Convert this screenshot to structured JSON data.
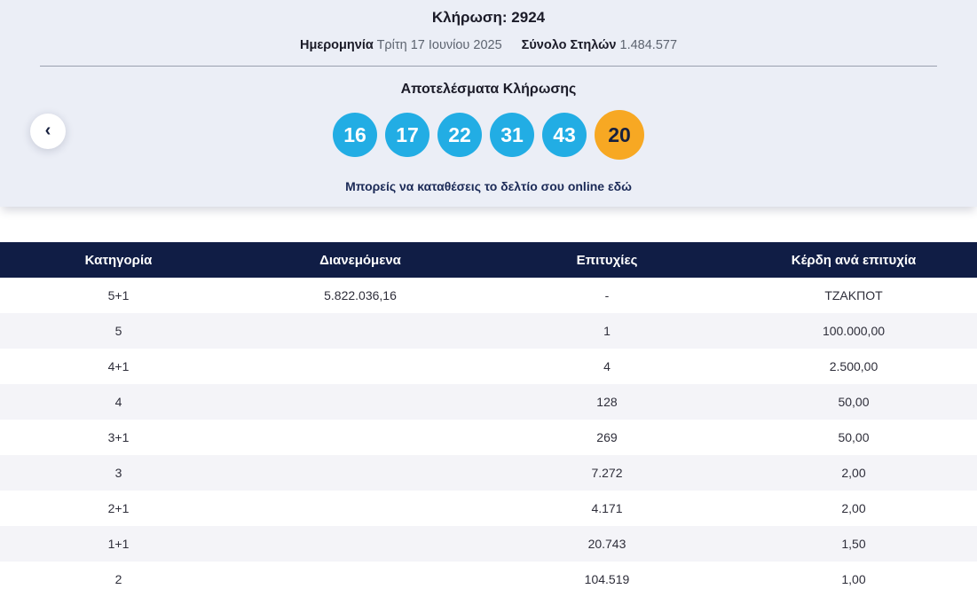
{
  "header": {
    "title": "Κλήρωση: 2924",
    "date_label": "Ημερομηνία",
    "date_value": "Τρίτη 17 Ιουνίου 2025",
    "columns_label": "Σύνολο Στηλών",
    "columns_value": "1.484.577"
  },
  "results": {
    "title": "Αποτελέσματα Κλήρωσης",
    "numbers": [
      "16",
      "17",
      "22",
      "31",
      "43"
    ],
    "bonus": "20",
    "link_text": "Μπορείς να καταθέσεις το δελτίο σου online εδώ"
  },
  "nav": {
    "prev_icon": "‹"
  },
  "colors": {
    "ball_blue": "#22ade4",
    "ball_orange": "#f7a823",
    "table_header_bg": "#101d45",
    "hero_bg": "#ebeef6"
  },
  "table": {
    "headers": [
      "Κατηγορία",
      "Διανεμόμενα",
      "Επιτυχίες",
      "Κέρδη ανά επιτυχία"
    ],
    "rows": [
      {
        "category": "5+1",
        "dividend": "5.822.036,16",
        "winners": "-",
        "prize": "ΤΖΑΚΠΟΤ"
      },
      {
        "category": "5",
        "dividend": "",
        "winners": "1",
        "prize": "100.000,00"
      },
      {
        "category": "4+1",
        "dividend": "",
        "winners": "4",
        "prize": "2.500,00"
      },
      {
        "category": "4",
        "dividend": "",
        "winners": "128",
        "prize": "50,00"
      },
      {
        "category": "3+1",
        "dividend": "",
        "winners": "269",
        "prize": "50,00"
      },
      {
        "category": "3",
        "dividend": "",
        "winners": "7.272",
        "prize": "2,00"
      },
      {
        "category": "2+1",
        "dividend": "",
        "winners": "4.171",
        "prize": "2,00"
      },
      {
        "category": "1+1",
        "dividend": "",
        "winners": "20.743",
        "prize": "1,50"
      },
      {
        "category": "2",
        "dividend": "",
        "winners": "104.519",
        "prize": "1,00"
      }
    ]
  }
}
